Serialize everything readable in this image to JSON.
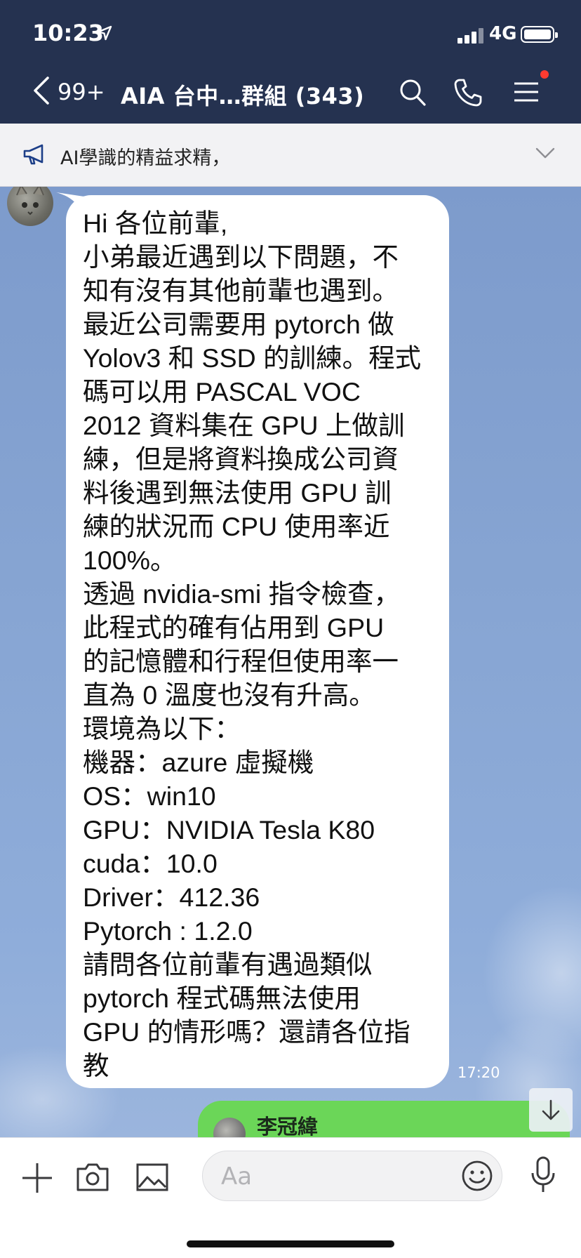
{
  "status_bar": {
    "time": "10:23",
    "network": "4G"
  },
  "header": {
    "back_count": "99+",
    "title": "AIA 台中…群組 (343)",
    "icons": [
      "search-icon",
      "phone-icon",
      "menu-icon"
    ],
    "menu_badge_color": "#ff3b30",
    "background_color": "#253250"
  },
  "announcement": {
    "text": "AI學識的精益求精，"
  },
  "messages": [
    {
      "side": "left",
      "text": "Hi 各位前輩,\n小弟最近遇到以下問題，不\n知有沒有其他前輩也遇到。\n最近公司需要用 pytorch 做\nYolov3 和 SSD 的訓練。程式\n碼可以用 PASCAL VOC\n2012 資料集在 GPU 上做訓\n練，但是將資料換成公司資\n料後遇到無法使用 GPU 訓\n練的狀況而 CPU 使用率近\n100%。\n透過 nvidia-smi 指令檢查，\n此程式的確有佔用到 GPU\n的記憶體和行程但使用率一\n直為 0 溫度也沒有升高。\n環境為以下：\n機器：azure 虛擬機\nOS：win10\nGPU：NVIDIA Tesla K80\ncuda：10.0\nDriver：412.36\nPytorch : 1.2.0\n請問各位前輩有遇過類似\npytorch 程式碼無法使用\nGPU 的情形嗎？還請各位指\n教",
      "time": "17:20"
    },
    {
      "side": "right",
      "sender_name": "李冠緯",
      "bubble_color": "#6bd658"
    }
  ],
  "composer": {
    "placeholder": "Aa",
    "icons": [
      "plus-icon",
      "camera-icon",
      "image-icon",
      "emoji-icon",
      "microphone-icon"
    ]
  }
}
